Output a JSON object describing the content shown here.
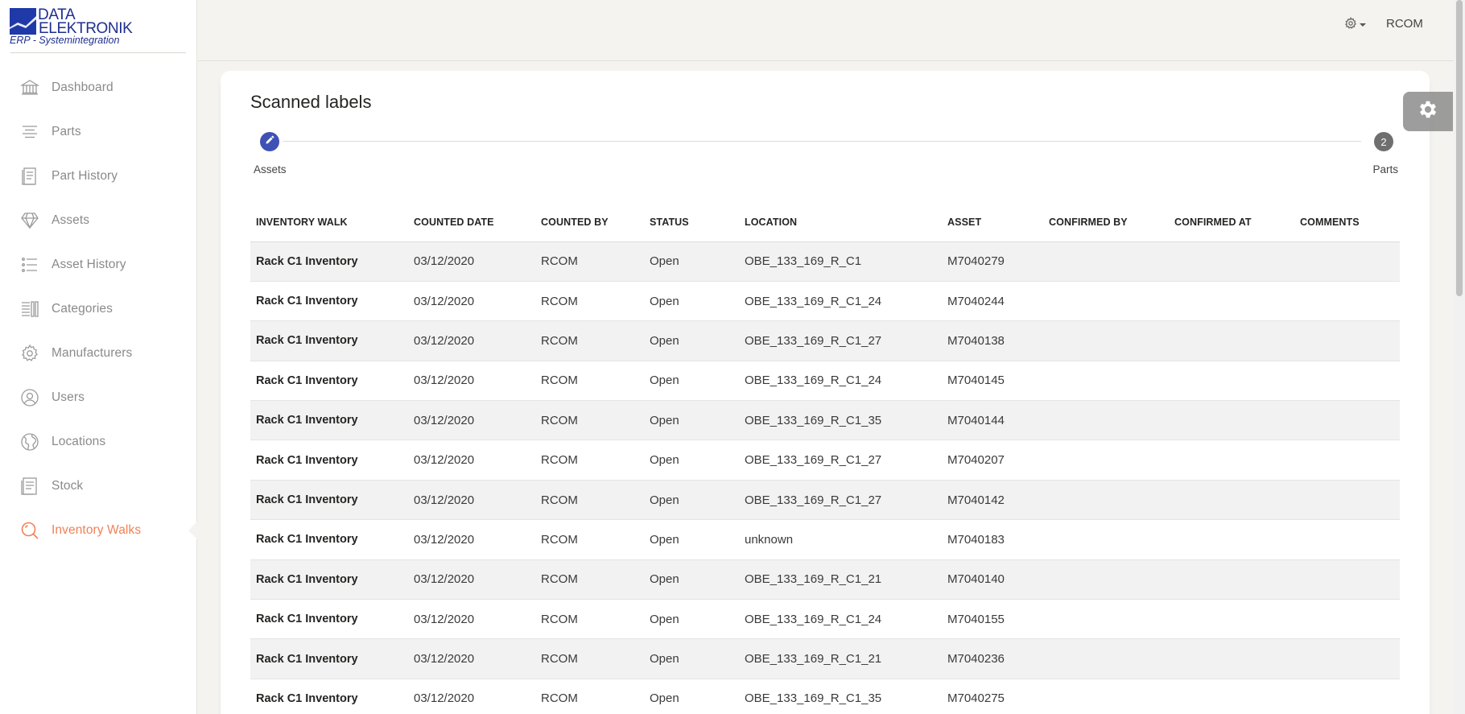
{
  "logo": {
    "line1": "DATA",
    "line2": "ELEKTRONIK",
    "tagline": "ERP - Systemintegration"
  },
  "sidebar": {
    "items": [
      {
        "label": "Dashboard",
        "icon": "bank-icon"
      },
      {
        "label": "Parts",
        "icon": "align-icon"
      },
      {
        "label": "Part History",
        "icon": "paper-icon"
      },
      {
        "label": "Assets",
        "icon": "diamond-icon"
      },
      {
        "label": "Asset History",
        "icon": "list-icon"
      },
      {
        "label": "Categories",
        "icon": "columns-icon"
      },
      {
        "label": "Manufacturers",
        "icon": "gear-icon"
      },
      {
        "label": "Users",
        "icon": "user-circle-icon"
      },
      {
        "label": "Locations",
        "icon": "globe-icon"
      },
      {
        "label": "Stock",
        "icon": "document-icon"
      },
      {
        "label": "Inventory Walks",
        "icon": "magnifier-icon",
        "active": true
      }
    ],
    "active_color": "#ef8157"
  },
  "topbar": {
    "settings_icon": "gear-icon",
    "user": "RCOM"
  },
  "card": {
    "title": "Scanned labels",
    "stepper": {
      "step1_label": "Assets",
      "step2_label": "Parts",
      "step2_number": "2"
    },
    "table": {
      "headers": [
        "INVENTORY WALK",
        "COUNTED DATE",
        "COUNTED BY",
        "STATUS",
        "LOCATION",
        "ASSET",
        "CONFIRMED BY",
        "CONFIRMED AT",
        "COMMENTS"
      ],
      "rows": [
        [
          "Rack C1 Inventory",
          "03/12/2020",
          "RCOM",
          "Open",
          "OBE_133_169_R_C1",
          "M7040279",
          "",
          "",
          ""
        ],
        [
          "Rack C1 Inventory",
          "03/12/2020",
          "RCOM",
          "Open",
          "OBE_133_169_R_C1_24",
          "M7040244",
          "",
          "",
          ""
        ],
        [
          "Rack C1 Inventory",
          "03/12/2020",
          "RCOM",
          "Open",
          "OBE_133_169_R_C1_27",
          "M7040138",
          "",
          "",
          ""
        ],
        [
          "Rack C1 Inventory",
          "03/12/2020",
          "RCOM",
          "Open",
          "OBE_133_169_R_C1_24",
          "M7040145",
          "",
          "",
          ""
        ],
        [
          "Rack C1 Inventory",
          "03/12/2020",
          "RCOM",
          "Open",
          "OBE_133_169_R_C1_35",
          "M7040144",
          "",
          "",
          ""
        ],
        [
          "Rack C1 Inventory",
          "03/12/2020",
          "RCOM",
          "Open",
          "OBE_133_169_R_C1_27",
          "M7040207",
          "",
          "",
          ""
        ],
        [
          "Rack C1 Inventory",
          "03/12/2020",
          "RCOM",
          "Open",
          "OBE_133_169_R_C1_27",
          "M7040142",
          "",
          "",
          ""
        ],
        [
          "Rack C1 Inventory",
          "03/12/2020",
          "RCOM",
          "Open",
          "unknown",
          "M7040183",
          "",
          "",
          ""
        ],
        [
          "Rack C1 Inventory",
          "03/12/2020",
          "RCOM",
          "Open",
          "OBE_133_169_R_C1_21",
          "M7040140",
          "",
          "",
          ""
        ],
        [
          "Rack C1 Inventory",
          "03/12/2020",
          "RCOM",
          "Open",
          "OBE_133_169_R_C1_24",
          "M7040155",
          "",
          "",
          ""
        ],
        [
          "Rack C1 Inventory",
          "03/12/2020",
          "RCOM",
          "Open",
          "OBE_133_169_R_C1_21",
          "M7040236",
          "",
          "",
          ""
        ],
        [
          "Rack C1 Inventory",
          "03/12/2020",
          "RCOM",
          "Open",
          "OBE_133_169_R_C1_35",
          "M7040275",
          "",
          "",
          ""
        ]
      ]
    }
  },
  "plugin": {
    "icon": "gear-icon"
  }
}
